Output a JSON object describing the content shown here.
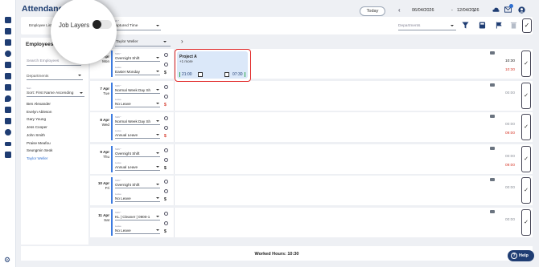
{
  "app": {
    "title": "Attendance"
  },
  "header": {
    "today": "Today",
    "date_from": "06/04/2026",
    "dash": "-",
    "date_to": "12/04/2026"
  },
  "toolbar": {
    "employee_list": "Employee List",
    "time_label": "Shift *",
    "time_value": "Captured Time",
    "departments_placeholder": "Departments"
  },
  "spotlight": {
    "label": "Job Layers"
  },
  "left": {
    "heading": "Employees",
    "search_placeholder": "Search Employees",
    "departments": "Departments",
    "sort_label": "Sort",
    "sort_value": "Sort: First Name Ascending",
    "employees": [
      "Ben Alexander",
      "Evelyn Ableson",
      "Gary Young",
      "Jess Cooper",
      "John Smith",
      "Praise Meafou",
      "Seungmin Seok",
      "Taylor Weller"
    ],
    "selected": "Taylor Weller"
  },
  "selected_employee": "Taylor Weller",
  "shift_card": {
    "title": "Project A",
    "more": "+1 more",
    "start": "21:00",
    "end": "07:30"
  },
  "rows": [
    {
      "day": "6 Apr",
      "dow": "Mon",
      "shift_label": "Shift *",
      "shift": "Overnight Shift",
      "leave_label": "Leave",
      "leave": "Easter Monday",
      "t1": "10:30",
      "t1c": "dark",
      "t2": "10:30",
      "t2c": "red"
    },
    {
      "day": "7 Apr",
      "dow": "Tue",
      "shift_label": "Shift *",
      "shift": "Normal Week Day Sh",
      "leave_label": "Leave",
      "leave": "No Leave",
      "t1": "00:00",
      "t1c": "grey",
      "t2": "",
      "t2c": ""
    },
    {
      "day": "8 Apr",
      "dow": "Wed",
      "shift_label": "Shift *",
      "shift": "Normal Week Day Sh",
      "leave_label": "Leave",
      "leave": "Annual Leave",
      "t1": "00:00",
      "t1c": "grey",
      "t2": "09:00",
      "t2c": "red"
    },
    {
      "day": "9 Apr",
      "dow": "Thu",
      "shift_label": "Shift *",
      "shift": "Overnight Shift",
      "leave_label": "Leave",
      "leave": "Annual Leave",
      "t1": "00:00",
      "t1c": "grey",
      "t2": "09:00",
      "t2c": "red"
    },
    {
      "day": "10 Apr",
      "dow": "Fri",
      "shift_label": "Shift *",
      "shift": "Overnight Shift",
      "leave_label": "Leave",
      "leave": "No Leave",
      "t1": "00:00",
      "t1c": "grey",
      "t2": "",
      "t2c": ""
    },
    {
      "day": "11 Apr",
      "dow": "Sat",
      "shift_label": "Shift *",
      "shift": "KL | Cleaner | 0900-1",
      "leave_label": "Leave",
      "leave": "No Leave",
      "t1": "00:00",
      "t1c": "grey",
      "t2": "",
      "t2c": ""
    }
  ],
  "footer": {
    "worked_hours": "Worked Hours: 10:30"
  },
  "help": {
    "label": "Help"
  },
  "icons": [
    "dashboard-icon",
    "list-icon",
    "users-icon",
    "clock-icon",
    "sitemap-icon",
    "clipboard-icon",
    "calendar-icon",
    "location-icon",
    "building-icon",
    "document-icon",
    "dollar-icon",
    "plane-icon",
    "phone-icon",
    "gear-icon",
    "cloud-icon",
    "mail-icon",
    "account-icon",
    "filter-icon",
    "calculator-icon",
    "flag-icon",
    "trash-icon",
    "comment-icon",
    "help-icon"
  ],
  "colors": {
    "brand": "#1f3d73",
    "accent": "#2f6fd0",
    "alert": "#e02424",
    "highlight": "#dbe8f9"
  }
}
